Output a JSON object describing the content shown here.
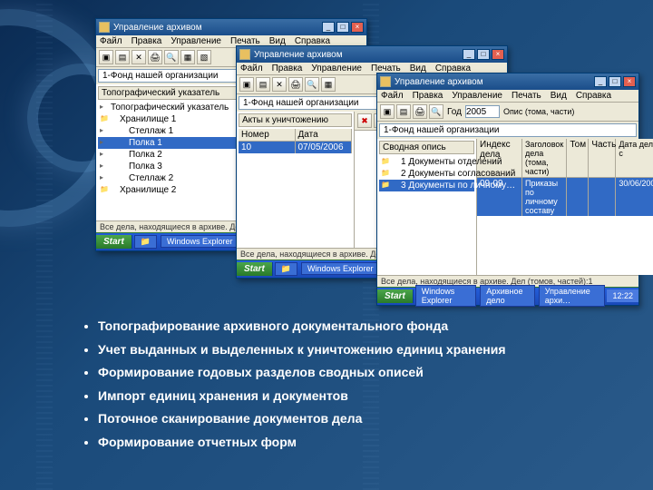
{
  "app_title": "Управление архивом",
  "menus": [
    "Файл",
    "Правка",
    "Управление",
    "Печать",
    "Вид",
    "Справка"
  ],
  "breadcrumb": "1-Фонд нашей организации",
  "winbuttons": {
    "min": "_",
    "max": "□",
    "close": "×"
  },
  "toolbar": {
    "year_label": "Год",
    "year_value": "2005",
    "opis_label": "Опис (тома, части)"
  },
  "windowA": {
    "sidebar_title": "Топографический указатель",
    "tree": [
      {
        "label": "Топографический указатель",
        "lvl": 1
      },
      {
        "label": "Хранилище 1",
        "lvl": 2
      },
      {
        "label": "Стеллаж 1",
        "lvl": 3
      },
      {
        "label": "Полка 1",
        "lvl": 3,
        "sel": true
      },
      {
        "label": "Полка 2",
        "lvl": 3
      },
      {
        "label": "Полка 3",
        "lvl": 3
      },
      {
        "label": "Стеллаж 2",
        "lvl": 3
      },
      {
        "label": "Хранилище 2",
        "lvl": 2
      }
    ],
    "status": "Все дела, находящиеся в архиве. Дел (томов, …"
  },
  "windowB": {
    "sidebar_title": "Акты к уничтожению",
    "cols": {
      "num": "Номер",
      "date": "Дата"
    },
    "row": {
      "num": "10",
      "date": "07/05/2006"
    },
    "status": "Все дела, находящиеся в архиве. Дел (томов, частей)…"
  },
  "windowC": {
    "sidebar_title": "Сводная опись",
    "tree": [
      {
        "label": "1 Документы отделений",
        "lvl": 2
      },
      {
        "label": "2 Документы согласований",
        "lvl": 2
      },
      {
        "label": "3 Документы по личному…",
        "lvl": 2,
        "sel": true
      }
    ],
    "grid_cols": {
      "index": "Индекс дела",
      "title": "Заголовок дела (тома, части)",
      "tom": "Том",
      "part": "Часть",
      "date": "Дата дела с"
    },
    "grid_row": {
      "index": "09-09",
      "title": "Приказы по личному составу",
      "date": "30/06/2005"
    },
    "status": "Все дела, находящиеся в архиве. Дел (томов, частей):1"
  },
  "taskbar": {
    "start": "Start",
    "tasks_a": [
      "",
      "Windows Explorer"
    ],
    "tasks_c": [
      "Windows Explorer",
      "Архивное дело",
      "Управление архи…"
    ],
    "time": "12:22"
  },
  "bullets": [
    "Топографирование архивного документального фонда",
    "Учет выданных и выделенных к уничтожению единиц хранения",
    "Формирование годовых разделов сводных описей",
    "Импорт единиц хранения и документов",
    "Поточное сканирование документов дела",
    "Формирование отчетных форм"
  ]
}
